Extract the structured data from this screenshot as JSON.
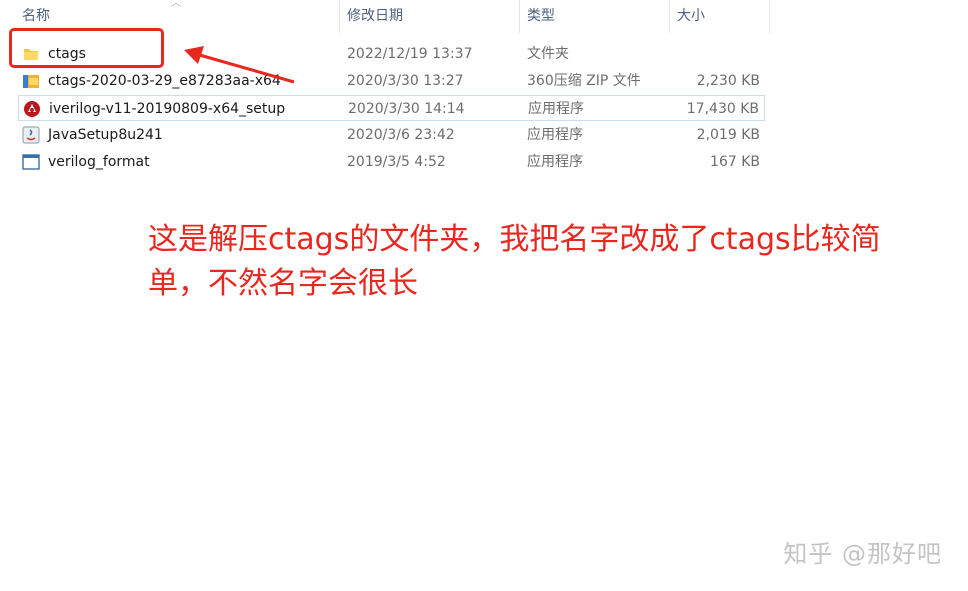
{
  "columns": {
    "name": "名称",
    "date": "修改日期",
    "type": "类型",
    "size": "大小"
  },
  "files": [
    {
      "name": "ctags",
      "date": "2022/12/19 13:37",
      "type": "文件夹",
      "size": "",
      "icon": "folder-icon"
    },
    {
      "name": "ctags-2020-03-29_e87283aa-x64",
      "date": "2020/3/30 13:27",
      "type": "360压缩 ZIP 文件",
      "size": "2,230 KB",
      "icon": "zip-archive-icon"
    },
    {
      "name": "iverilog-v11-20190809-x64_setup",
      "date": "2020/3/30 14:14",
      "type": "应用程序",
      "size": "17,430 KB",
      "icon": "installer-icon"
    },
    {
      "name": "JavaSetup8u241",
      "date": "2020/3/6 23:42",
      "type": "应用程序",
      "size": "2,019 KB",
      "icon": "java-icon"
    },
    {
      "name": "verilog_format",
      "date": "2019/3/5 4:52",
      "type": "应用程序",
      "size": "167 KB",
      "icon": "app-window-icon"
    }
  ],
  "annotation": {
    "line1": "这是解压ctags的文件夹，我把名字改成了ctags比较简",
    "line2": "单，不然名字会很长"
  },
  "watermark": "知乎 @那好吧",
  "colors": {
    "accent_red": "#e8271f",
    "header_text": "#4d6082",
    "selection_border": "#c9def5"
  }
}
